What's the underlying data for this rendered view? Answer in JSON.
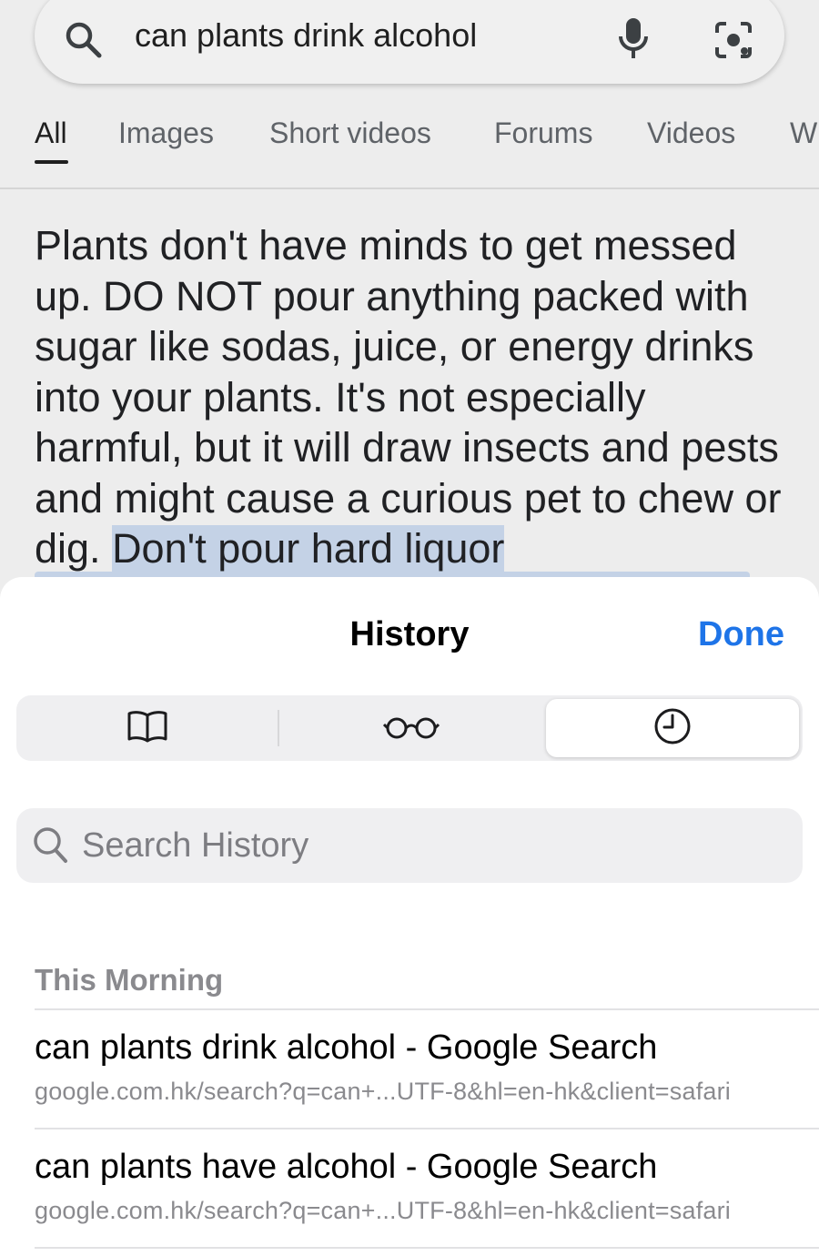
{
  "google": {
    "query": "can plants drink alcohol",
    "tabs": [
      "All",
      "Images",
      "Short videos",
      "Forums",
      "Videos",
      "W"
    ],
    "snippet_plain": "Plants don't have minds to get messed up. DO NOT pour anything packed with sugar like sodas, juice, or energy drinks into your plants. It's not especially harmful, but it will draw insects and pests and might cause a curious pet to chew or dig. ",
    "snippet_highlight": "Don't pour hard liquor"
  },
  "history": {
    "title": "History",
    "done_label": "Done",
    "segments": [
      {
        "icon": "book-icon"
      },
      {
        "icon": "reading-list-glasses-icon"
      },
      {
        "icon": "history-clock-icon",
        "selected": true
      }
    ],
    "search_placeholder": "Search History",
    "section": "This Morning",
    "items": [
      {
        "title": "can plants drink alcohol - Google Search",
        "url": "google.com.hk/search?q=can+...UTF-8&hl=en-hk&client=safari"
      },
      {
        "title": "can plants have alcohol - Google Search",
        "url": "google.com.hk/search?q=can+...UTF-8&hl=en-hk&client=safari"
      }
    ]
  },
  "colors": {
    "accent": "#1e74e8",
    "highlight": "#c4d2e6"
  }
}
